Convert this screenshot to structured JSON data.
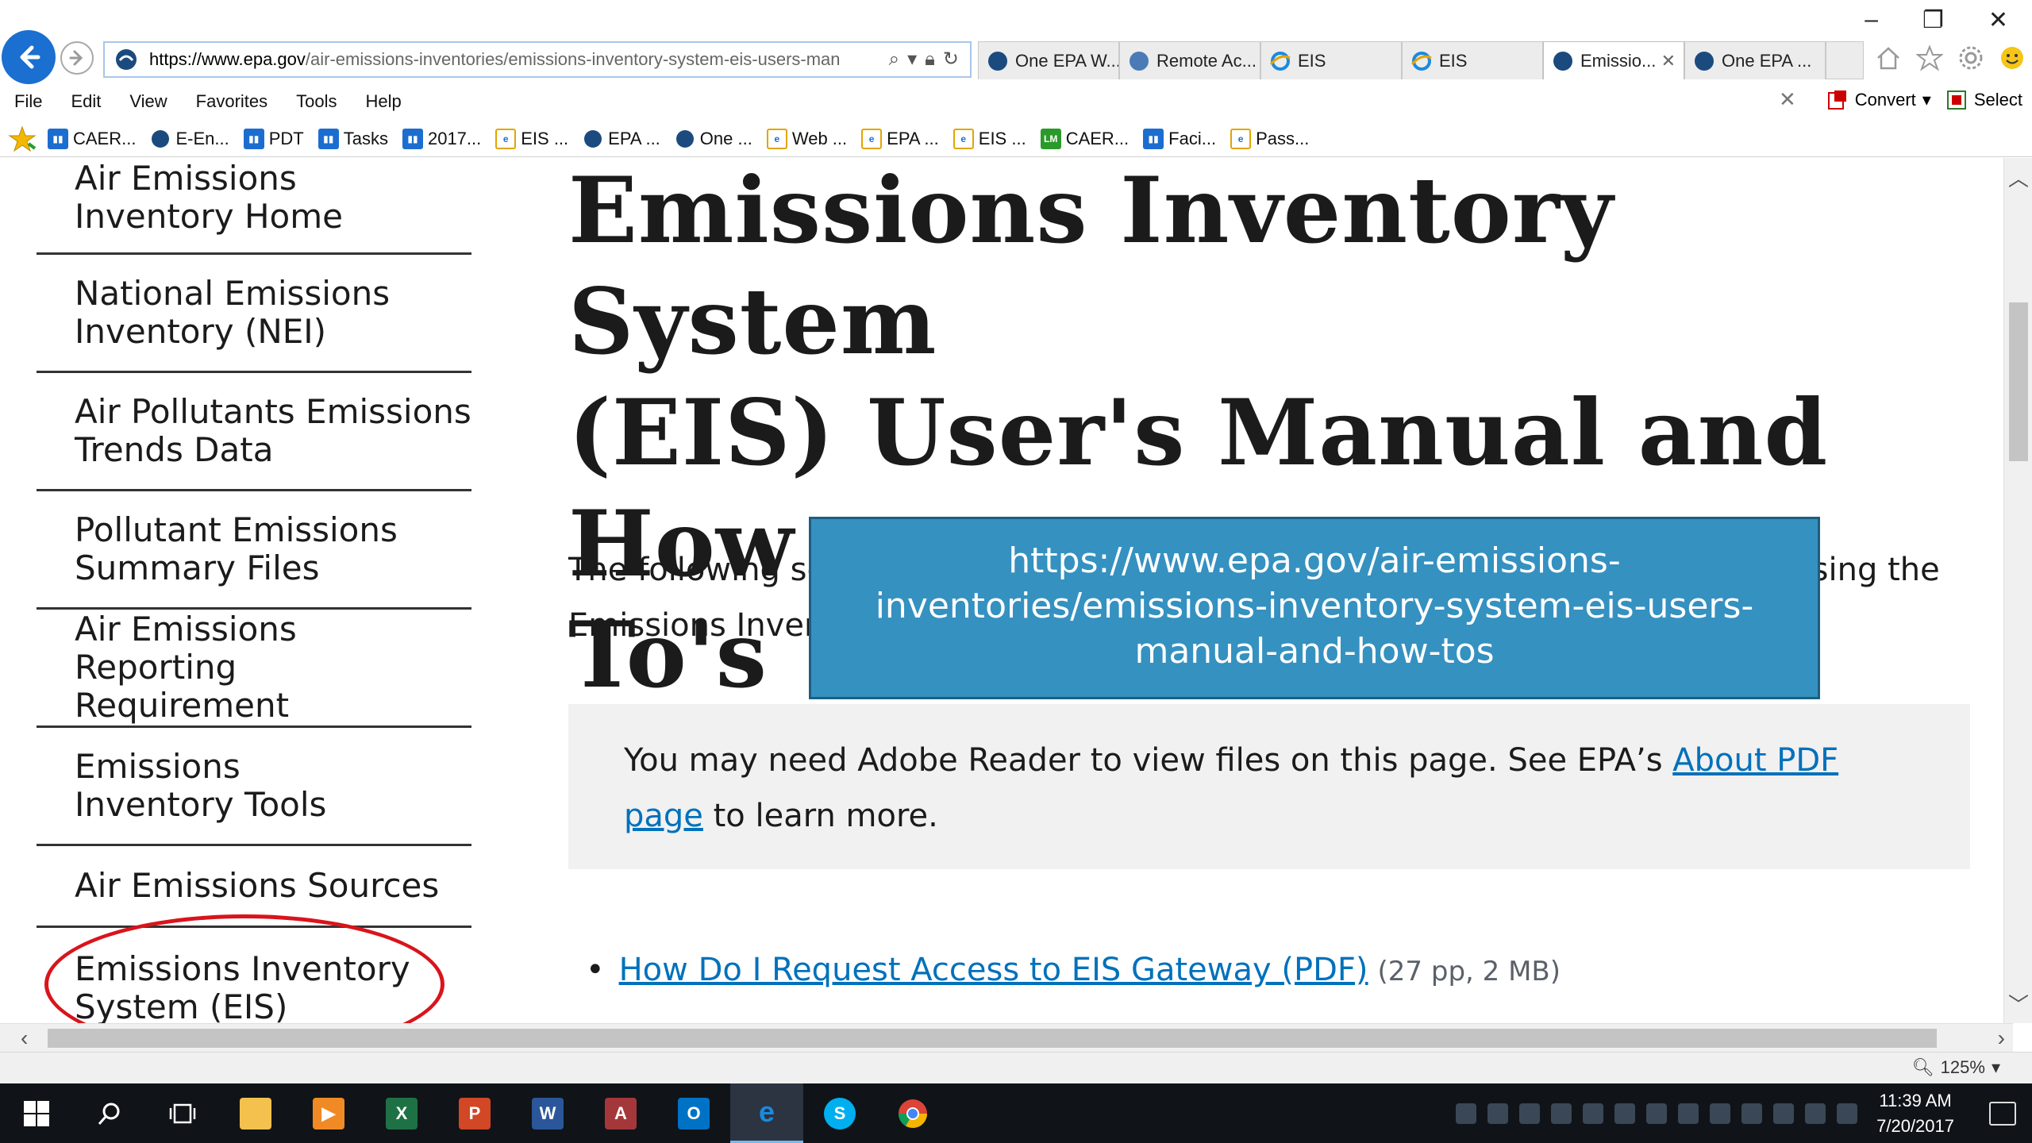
{
  "browser": {
    "address": {
      "host": "https://www.epa.gov",
      "path": "/air-emissions-inventories/emissions-inventory-system-eis-users-man"
    },
    "tabs": [
      {
        "label": "One EPA W...",
        "icon": "epa-icon",
        "active": false
      },
      {
        "label": "Remote Ac...",
        "icon": "globe-icon",
        "active": false
      },
      {
        "label": "EIS",
        "icon": "ie-icon",
        "active": false
      },
      {
        "label": "EIS",
        "icon": "ie-icon",
        "active": false
      },
      {
        "label": "Emissio...",
        "icon": "epa-icon",
        "active": true
      },
      {
        "label": "One EPA ...",
        "icon": "epa-icon",
        "active": false
      }
    ],
    "menu": [
      "File",
      "Edit",
      "View",
      "Favorites",
      "Tools",
      "Help"
    ],
    "menu_right": {
      "convert": "Convert",
      "select": "Select"
    },
    "favorites": [
      {
        "label": "CAER...",
        "icon": "blue"
      },
      {
        "label": "E-En...",
        "icon": "epa"
      },
      {
        "label": "PDT",
        "icon": "blue"
      },
      {
        "label": "Tasks",
        "icon": "blue"
      },
      {
        "label": "2017...",
        "icon": "blue"
      },
      {
        "label": "EIS ...",
        "icon": "ie"
      },
      {
        "label": "EPA ...",
        "icon": "epa"
      },
      {
        "label": "One ...",
        "icon": "epa"
      },
      {
        "label": "Web ...",
        "icon": "ie"
      },
      {
        "label": "EPA ...",
        "icon": "ie"
      },
      {
        "label": "EIS ...",
        "icon": "ie"
      },
      {
        "label": "CAER...",
        "icon": "green"
      },
      {
        "label": "Faci...",
        "icon": "blue"
      },
      {
        "label": "Pass...",
        "icon": "ie"
      }
    ],
    "zoom": "125%"
  },
  "sidebar": {
    "items": [
      {
        "label": "Air Emissions Inventory Home"
      },
      {
        "label": "National Emissions Inventory (NEI)"
      },
      {
        "label": "Air Pollutants Emissions Trends Data"
      },
      {
        "label": "Pollutant Emissions Summary Files"
      },
      {
        "label": "Air Emissions Reporting Requirement"
      },
      {
        "label": "Emissions Inventory Tools"
      },
      {
        "label": "Air Emissions Sources"
      },
      {
        "label": "Emissions Inventory System (EIS) Gateway"
      }
    ]
  },
  "main": {
    "title_line1": "Emissions Inventory System",
    "title_line2": "(EIS) User's Manual and How",
    "title_line3": "To's",
    "intro": "The following sections of the EIS User's Manual are available to assist you in using the Emissions Inventory System.",
    "notice": {
      "before": "You may need Adobe Reader to view files on this page. See EPA’s ",
      "link": "About PDF page",
      "after": " to learn more."
    },
    "links": [
      {
        "label": "How Do I Request Access to EIS Gateway (PDF)",
        "meta": "(27 pp, 2 MB)"
      }
    ]
  },
  "callout": {
    "text": "https://www.epa.gov/air-emissions-inventories/emissions-inventory-system-eis-users-manual-and-how-tos"
  },
  "taskbar": {
    "time": "11:39 AM",
    "date": "7/20/2017"
  },
  "colors": {
    "link": "#0071bc",
    "callout_bg": "#3591c0",
    "annotation": "#d9141c"
  }
}
